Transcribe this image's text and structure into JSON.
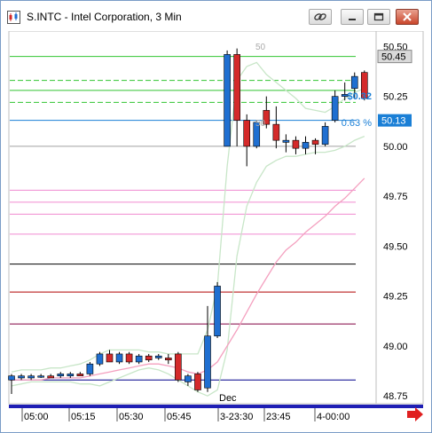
{
  "window": {
    "title": "S.INTC - Intel Corporation, 3 Min"
  },
  "icons": {
    "app": "chart-app-icon",
    "link": "link-icon",
    "minimize": "minimize-icon",
    "maximize": "maximize-icon",
    "close": "close-icon",
    "next_arrow": "right-arrow-icon"
  },
  "colors": {
    "up_candle": "#1f6fd1",
    "down_candle": "#d42a2a",
    "change_text": "#1a7fd6",
    "last_price_box": "#1a7fd6",
    "highlight_box": "#d9d9d9",
    "green_line": "#31c431",
    "pink_line": "#f08ad0",
    "black_line": "#000000",
    "darkred_line": "#b00000",
    "purple_line": "#800040",
    "navy_line": "#00008b"
  },
  "chart_data": {
    "type": "candlestick",
    "title": "S.INTC - Intel Corporation, 3 Min",
    "price_ticks": [
      "50.50",
      "50.25",
      "50.00",
      "49.75",
      "49.50",
      "49.25",
      "49.00",
      "48.75"
    ],
    "ylim": [
      48.72,
      50.58
    ],
    "time_ticks": [
      "05:00",
      "05:15",
      "05:30",
      "05:45",
      "3-23:30",
      "23:45",
      "4-00:00"
    ],
    "date_divider_label": "Dec",
    "highlight_price": "50.45",
    "last_price": "50.13",
    "change_amount": "$0.32",
    "change_percent": "0.63 %",
    "band_label": "50",
    "candles": [
      {
        "o": 48.83,
        "h": 48.86,
        "l": 48.76,
        "c": 48.85
      },
      {
        "o": 48.84,
        "h": 48.86,
        "l": 48.83,
        "c": 48.85
      },
      {
        "o": 48.84,
        "h": 48.86,
        "l": 48.83,
        "c": 48.85
      },
      {
        "o": 48.85,
        "h": 48.86,
        "l": 48.84,
        "c": 48.85
      },
      {
        "o": 48.85,
        "h": 48.86,
        "l": 48.84,
        "c": 48.84
      },
      {
        "o": 48.85,
        "h": 48.87,
        "l": 48.84,
        "c": 48.86
      },
      {
        "o": 48.85,
        "h": 48.87,
        "l": 48.84,
        "c": 48.86
      },
      {
        "o": 48.86,
        "h": 48.87,
        "l": 48.85,
        "c": 48.85
      },
      {
        "o": 48.86,
        "h": 48.92,
        "l": 48.85,
        "c": 48.91
      },
      {
        "o": 48.91,
        "h": 48.97,
        "l": 48.9,
        "c": 48.96
      },
      {
        "o": 48.96,
        "h": 48.98,
        "l": 48.92,
        "c": 48.92
      },
      {
        "o": 48.92,
        "h": 48.97,
        "l": 48.91,
        "c": 48.96
      },
      {
        "o": 48.96,
        "h": 48.97,
        "l": 48.91,
        "c": 48.92
      },
      {
        "o": 48.92,
        "h": 48.96,
        "l": 48.91,
        "c": 48.95
      },
      {
        "o": 48.95,
        "h": 48.96,
        "l": 48.92,
        "c": 48.93
      },
      {
        "o": 48.94,
        "h": 48.96,
        "l": 48.93,
        "c": 48.95
      },
      {
        "o": 48.94,
        "h": 48.96,
        "l": 48.91,
        "c": 48.93
      },
      {
        "o": 48.96,
        "h": 48.97,
        "l": 48.82,
        "c": 48.83
      },
      {
        "o": 48.82,
        "h": 48.86,
        "l": 48.8,
        "c": 48.85
      },
      {
        "o": 48.86,
        "h": 48.87,
        "l": 48.77,
        "c": 48.78
      },
      {
        "o": 48.79,
        "h": 49.2,
        "l": 48.77,
        "c": 49.05
      },
      {
        "o": 49.05,
        "h": 49.32,
        "l": 49.04,
        "c": 49.3
      },
      {
        "o": 50.0,
        "h": 50.48,
        "l": 50.0,
        "c": 50.46
      },
      {
        "o": 50.46,
        "h": 50.49,
        "l": 50.0,
        "c": 50.13
      },
      {
        "o": 50.13,
        "h": 50.16,
        "l": 49.9,
        "c": 50.0
      },
      {
        "o": 50.0,
        "h": 50.13,
        "l": 49.99,
        "c": 50.12
      },
      {
        "o": 50.18,
        "h": 50.25,
        "l": 50.09,
        "c": 50.11
      },
      {
        "o": 50.11,
        "h": 50.2,
        "l": 49.99,
        "c": 50.03
      },
      {
        "o": 50.02,
        "h": 50.06,
        "l": 49.97,
        "c": 50.03
      },
      {
        "o": 50.03,
        "h": 50.05,
        "l": 49.96,
        "c": 49.99
      },
      {
        "o": 49.99,
        "h": 50.05,
        "l": 49.96,
        "c": 50.02
      },
      {
        "o": 50.03,
        "h": 50.04,
        "l": 49.96,
        "c": 50.01
      },
      {
        "o": 50.01,
        "h": 50.12,
        "l": 50.0,
        "c": 50.1
      },
      {
        "o": 50.13,
        "h": 50.28,
        "l": 50.12,
        "c": 50.25
      },
      {
        "o": 50.25,
        "h": 50.32,
        "l": 50.23,
        "c": 50.26
      },
      {
        "o": 50.29,
        "h": 50.37,
        "l": 50.24,
        "c": 50.35
      },
      {
        "o": 50.37,
        "h": 50.38,
        "l": 50.23,
        "c": 50.24
      }
    ],
    "horizontal_lines": [
      {
        "price": 50.45,
        "color": "#31c431",
        "style": "solid"
      },
      {
        "price": 50.33,
        "color": "#31c431",
        "style": "dashed"
      },
      {
        "price": 50.28,
        "color": "#31c431",
        "style": "solid"
      },
      {
        "price": 50.22,
        "color": "#31c431",
        "style": "dashed"
      },
      {
        "price": 50.13,
        "color": "#1a7fd6",
        "style": "solid"
      },
      {
        "price": 50.0,
        "color": "#a0a0a0",
        "style": "solid"
      },
      {
        "price": 49.78,
        "color": "#f08ad0",
        "style": "solid"
      },
      {
        "price": 49.72,
        "color": "#f08ad0",
        "style": "solid"
      },
      {
        "price": 49.66,
        "color": "#f08ad0",
        "style": "solid"
      },
      {
        "price": 49.56,
        "color": "#f08ad0",
        "style": "solid"
      },
      {
        "price": 49.41,
        "color": "#000000",
        "style": "solid"
      },
      {
        "price": 49.27,
        "color": "#b00000",
        "style": "solid"
      },
      {
        "price": 49.11,
        "color": "#800040",
        "style": "solid"
      },
      {
        "price": 48.83,
        "color": "#00008b",
        "style": "solid"
      }
    ],
    "bollinger_upper": [
      48.87,
      48.88,
      48.88,
      48.88,
      48.89,
      48.89,
      48.9,
      48.91,
      48.93,
      48.96,
      48.98,
      48.98,
      48.98,
      48.98,
      48.97,
      48.97,
      48.96,
      48.96,
      48.96,
      48.96,
      49.08,
      49.3,
      49.9,
      50.33,
      50.4,
      50.42,
      50.36,
      50.32,
      50.28,
      50.24,
      50.19,
      50.18,
      50.17,
      50.2,
      50.24,
      50.27,
      50.29
    ],
    "bollinger_lower": [
      48.8,
      48.81,
      48.82,
      48.82,
      48.82,
      48.82,
      48.82,
      48.81,
      48.81,
      48.8,
      48.82,
      48.84,
      48.86,
      48.88,
      48.89,
      48.88,
      48.86,
      48.83,
      48.8,
      48.77,
      48.75,
      48.78,
      48.98,
      49.45,
      49.7,
      49.82,
      49.9,
      49.93,
      49.95,
      49.95,
      49.96,
      49.97,
      49.97,
      49.98,
      50.0,
      50.03,
      50.05
    ],
    "moving_average": [
      48.83,
      48.83,
      48.83,
      48.83,
      48.84,
      48.84,
      48.84,
      48.84,
      48.85,
      48.86,
      48.87,
      48.88,
      48.89,
      48.9,
      48.91,
      48.91,
      48.9,
      48.89,
      48.87,
      48.86,
      48.88,
      48.92,
      49.0,
      49.08,
      49.17,
      49.26,
      49.34,
      49.42,
      49.48,
      49.52,
      49.57,
      49.61,
      49.65,
      49.7,
      49.74,
      49.79,
      49.84
    ]
  }
}
